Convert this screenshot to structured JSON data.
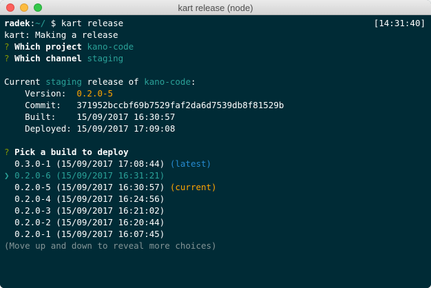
{
  "window": {
    "title": "kart release (node)"
  },
  "prompt": {
    "user": "radek",
    "path": "~/",
    "symbol": "$",
    "command": "kart release",
    "clock": "[14:31:40]"
  },
  "lines": {
    "making": "kart: Making a release",
    "q_mark": "?",
    "which_project": "Which project",
    "project": "kano-code",
    "which_channel": "Which channel",
    "channel": "staging",
    "current_prefix": "Current",
    "current_channel": "staging",
    "release_of": "release of",
    "current_project": "kano-code",
    "colon": ":",
    "version_label": "    Version:",
    "version_value": "0.2.0-5",
    "commit_label": "    Commit:",
    "commit_value": "371952bccbf69b7529faf2da6d7539db8f81529b",
    "built_label": "    Built:",
    "built_value": "15/09/2017 16:30:57",
    "deployed_label": "    Deployed:",
    "deployed_value": "15/09/2017 17:09:08",
    "pick": "Pick a build to deploy",
    "hint": "(Move up and down to reveal more choices)"
  },
  "builds": [
    {
      "text": "0.3.0-1 (15/09/2017 17:08:44)",
      "tag": "(latest)"
    },
    {
      "text": "0.2.0-6 (15/09/2017 16:31:21)",
      "tag": "",
      "pointer": "❯"
    },
    {
      "text": "0.2.0-5 (15/09/2017 16:30:57)",
      "tag": "(current)"
    },
    {
      "text": "0.2.0-4 (15/09/2017 16:24:56)",
      "tag": ""
    },
    {
      "text": "0.2.0-3 (15/09/2017 16:21:02)",
      "tag": ""
    },
    {
      "text": "0.2.0-2 (15/09/2017 16:20:44)",
      "tag": ""
    },
    {
      "text": "0.2.0-1 (15/09/2017 16:07:45)",
      "tag": ""
    }
  ]
}
